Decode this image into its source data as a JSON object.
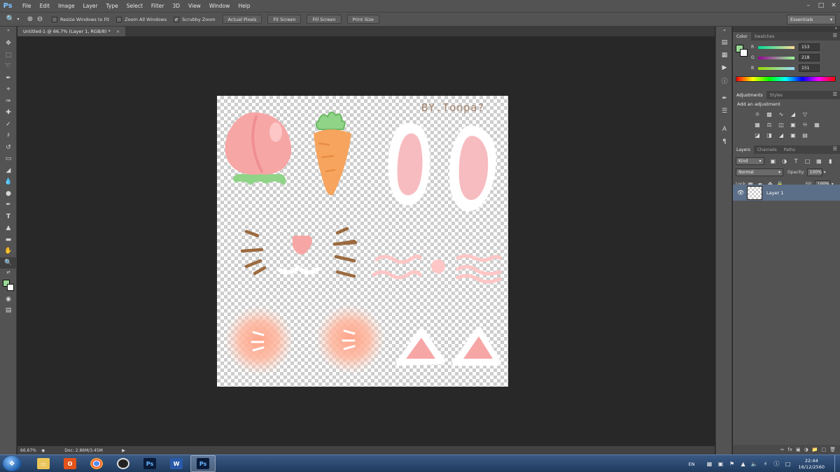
{
  "app": {
    "logo": "Ps"
  },
  "menu": [
    "File",
    "Edit",
    "Image",
    "Layer",
    "Type",
    "Select",
    "Filter",
    "3D",
    "View",
    "Window",
    "Help"
  ],
  "options_bar": {
    "resize_windows": "Resize Windows to Fit",
    "zoom_all": "Zoom All Windows",
    "scrubby_zoom": "Scrubby Zoom",
    "actual_pixels": "Actual Pixels",
    "fit_screen": "Fit Screen",
    "fill_screen": "Fill Screen",
    "print_size": "Print Size",
    "workspace": "Essentials"
  },
  "document": {
    "tab_title": "Untitled-1 @ 66.7% (Layer 1, RGB/8) *",
    "watermark": "BY.Tonpa?"
  },
  "status": {
    "zoom": "66.67%",
    "doc_size": "Doc: 2.86M/3.45M"
  },
  "color_panel": {
    "tabs": [
      "Color",
      "Swatches"
    ],
    "r_label": "R",
    "g_label": "G",
    "b_label": "B",
    "r": "153",
    "g": "218",
    "b": "151",
    "fg_color": "#99da97"
  },
  "adjustments_panel": {
    "tabs": [
      "Adjustments",
      "Styles"
    ],
    "title": "Add an adjustment"
  },
  "layers_panel": {
    "tabs": [
      "Layers",
      "Channels",
      "Paths"
    ],
    "kind": "Kind",
    "blend_mode": "Normal",
    "opacity_label": "Opacity:",
    "opacity": "100%",
    "lock_label": "Lock:",
    "fill_label": "Fill:",
    "fill": "100%",
    "layer_name": "Layer 1"
  },
  "taskbar": {
    "language": "EN",
    "time": "22:44",
    "date": "16/12/2560"
  }
}
